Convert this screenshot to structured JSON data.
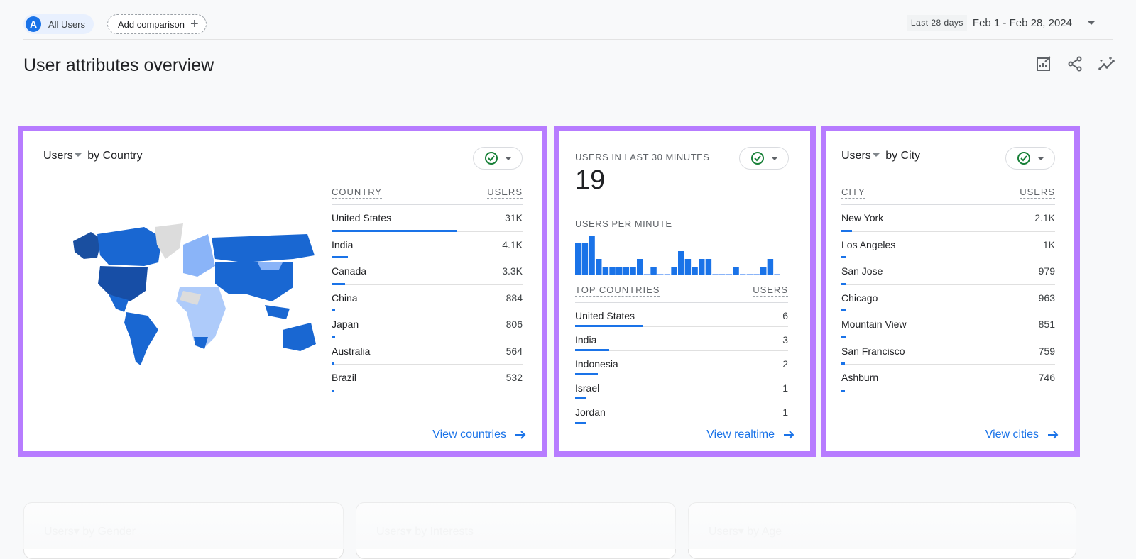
{
  "header": {
    "segment_avatar": "A",
    "segment_label": "All Users",
    "add_comparison_label": "Add comparison",
    "date_badge": "Last 28 days",
    "date_range": "Feb 1 - Feb 28, 2024"
  },
  "page_title": "User attributes overview",
  "toolbar_icons": [
    "customize-report-icon",
    "share-icon",
    "insights-icon"
  ],
  "country_card": {
    "metric": "Users",
    "by": "by",
    "dimension": "Country",
    "col_dimension": "COUNTRY",
    "col_metric": "USERS",
    "rows": [
      {
        "name": "United States",
        "value": "31K",
        "fraction": 1.0
      },
      {
        "name": "India",
        "value": "4.1K",
        "fraction": 0.13
      },
      {
        "name": "Canada",
        "value": "3.3K",
        "fraction": 0.106
      },
      {
        "name": "China",
        "value": "884",
        "fraction": 0.028
      },
      {
        "name": "Japan",
        "value": "806",
        "fraction": 0.026
      },
      {
        "name": "Australia",
        "value": "564",
        "fraction": 0.018
      },
      {
        "name": "Brazil",
        "value": "532",
        "fraction": 0.017
      }
    ],
    "link": "View countries"
  },
  "realtime_card": {
    "title": "USERS IN LAST 30 MINUTES",
    "value": "19",
    "per_minute_label": "USERS PER MINUTE",
    "col_dimension": "TOP COUNTRIES",
    "col_metric": "USERS",
    "rows": [
      {
        "name": "United States",
        "value": "6",
        "fraction": 1.0
      },
      {
        "name": "India",
        "value": "3",
        "fraction": 0.5
      },
      {
        "name": "Indonesia",
        "value": "2",
        "fraction": 0.333
      },
      {
        "name": "Israel",
        "value": "1",
        "fraction": 0.167
      },
      {
        "name": "Jordan",
        "value": "1",
        "fraction": 0.167
      }
    ],
    "link": "View realtime"
  },
  "city_card": {
    "metric": "Users",
    "by": "by",
    "dimension": "City",
    "col_dimension": "CITY",
    "col_metric": "USERS",
    "rows": [
      {
        "name": "New York",
        "value": "2.1K",
        "fraction": 0.068
      },
      {
        "name": "Los Angeles",
        "value": "1K",
        "fraction": 0.033
      },
      {
        "name": "San Jose",
        "value": "979",
        "fraction": 0.032
      },
      {
        "name": "Chicago",
        "value": "963",
        "fraction": 0.031
      },
      {
        "name": "Mountain View",
        "value": "851",
        "fraction": 0.027
      },
      {
        "name": "San Francisco",
        "value": "759",
        "fraction": 0.024
      },
      {
        "name": "Ashburn",
        "value": "746",
        "fraction": 0.024
      }
    ],
    "link": "View cities"
  },
  "ghost_cards": [
    "Users▾ by Gender",
    "Users▾ by Interests",
    "Users▾ by Age"
  ],
  "chart_data": {
    "type": "bar",
    "title": "USERS PER MINUTE",
    "xlabel": "",
    "ylabel": "",
    "categories": [
      "-30",
      "-29",
      "-28",
      "-27",
      "-26",
      "-25",
      "-24",
      "-23",
      "-22",
      "-21",
      "-20",
      "-19",
      "-18",
      "-17",
      "-16",
      "-15",
      "-14",
      "-13",
      "-12",
      "-11",
      "-10",
      "-9",
      "-8",
      "-7",
      "-6",
      "-5",
      "-4",
      "-3",
      "-2",
      "-1"
    ],
    "values": [
      4,
      4,
      5,
      2,
      1,
      1,
      1,
      1,
      1,
      2,
      0,
      1,
      0,
      0,
      1,
      3,
      2,
      1,
      2,
      2,
      0,
      0,
      0,
      1,
      0,
      0,
      0,
      1,
      2,
      0
    ],
    "ylim": [
      0,
      5
    ]
  },
  "colors": {
    "accent": "#1a73e8",
    "highlight_border": "#b77cff",
    "check_green": "#188038"
  }
}
